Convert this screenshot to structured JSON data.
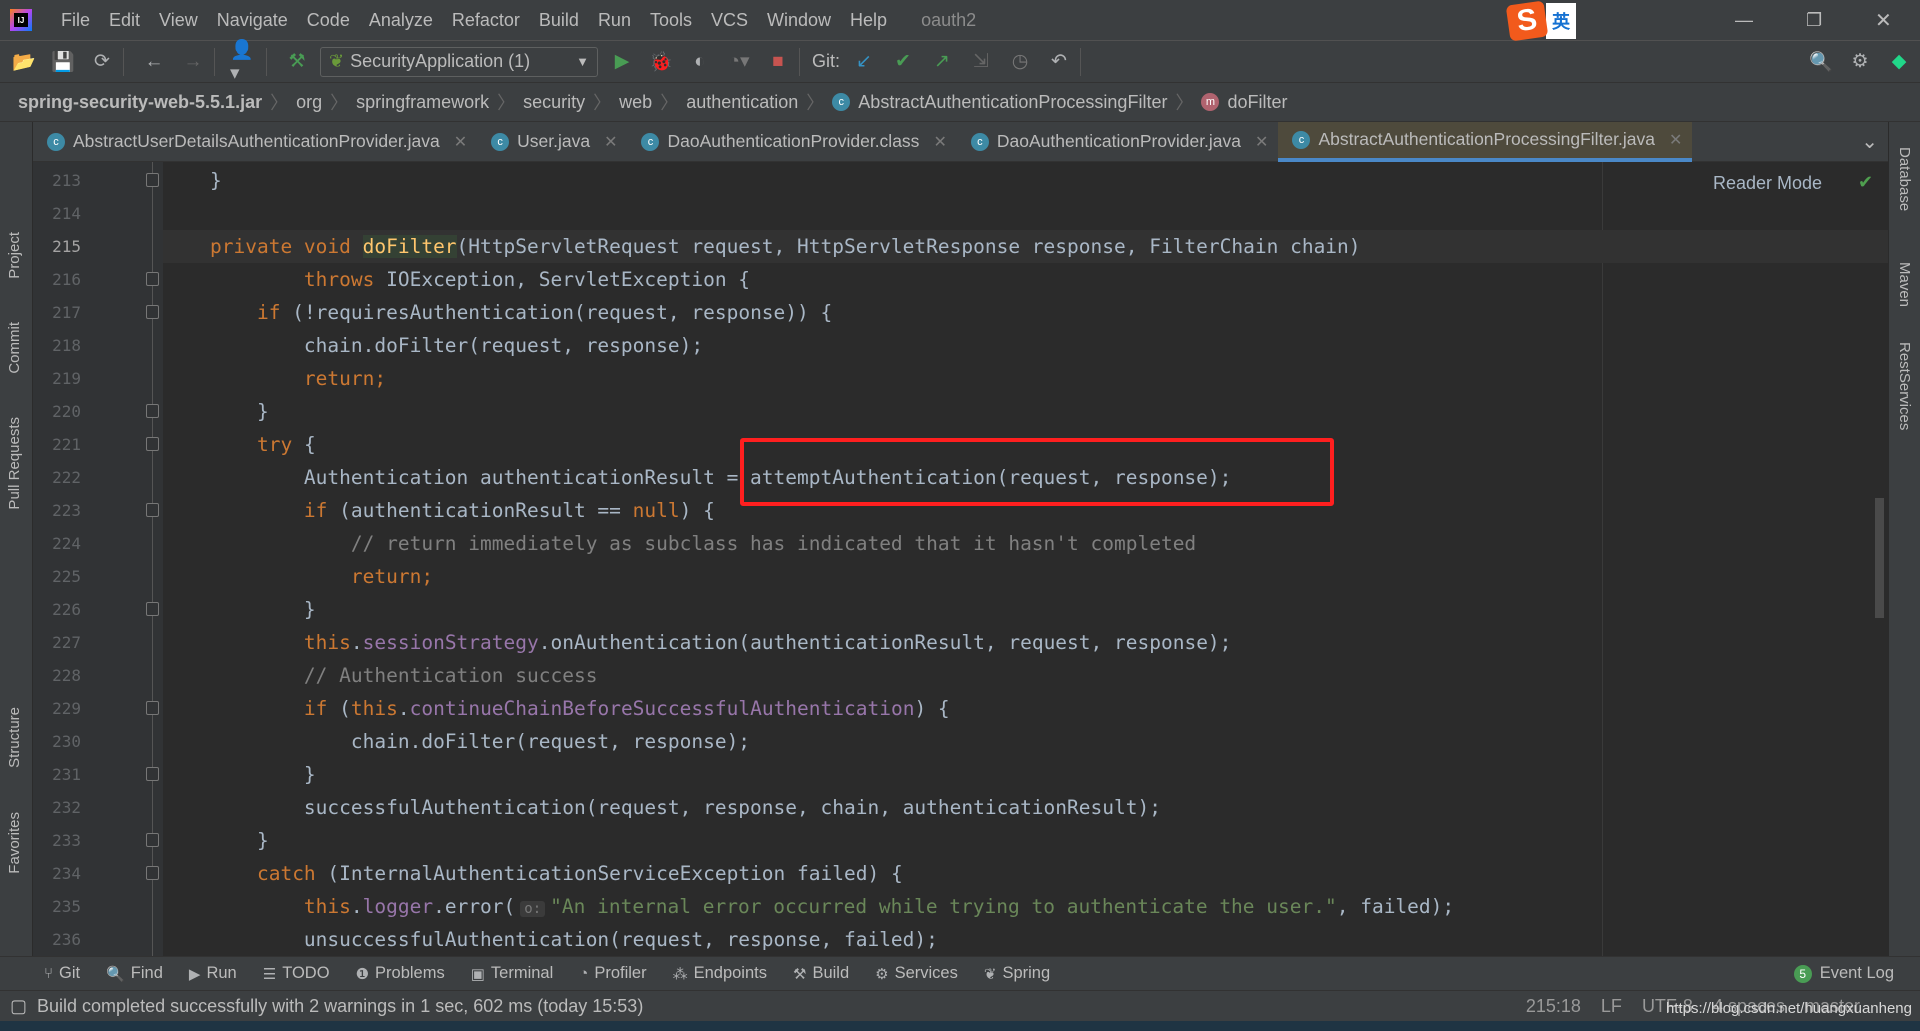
{
  "menubar": {
    "items": [
      "File",
      "Edit",
      "View",
      "Navigate",
      "Code",
      "Analyze",
      "Refactor",
      "Build",
      "Run",
      "Tools",
      "VCS",
      "Window",
      "Help"
    ],
    "project": "oauth2",
    "ime": "英"
  },
  "toolbar": {
    "run_config": "SecurityApplication (1)",
    "git_label": "Git:"
  },
  "breadcrumb": [
    "spring-security-web-5.5.1.jar",
    "org",
    "springframework",
    "security",
    "web",
    "authentication",
    "AbstractAuthenticationProcessingFilter",
    "doFilter"
  ],
  "tabs": [
    {
      "label": "AbstractUserDetailsAuthenticationProvider.java",
      "active": false
    },
    {
      "label": "User.java",
      "active": false
    },
    {
      "label": "DaoAuthenticationProvider.class",
      "active": false
    },
    {
      "label": "DaoAuthenticationProvider.java",
      "active": false
    },
    {
      "label": "AbstractAuthenticationProcessingFilter.java",
      "active": true
    }
  ],
  "left_tools": [
    "Project",
    "Commit",
    "Pull Requests",
    "Structure",
    "Favorites"
  ],
  "right_tools": [
    "Database",
    "Maven",
    "RestServices"
  ],
  "editor": {
    "reader_mode": "Reader Mode",
    "current_line": 215,
    "highlight_color": "#ff1f1f",
    "lines": [
      {
        "n": 213,
        "fold": true,
        "t": [
          [
            "}",
            ""
          ]
        ]
      },
      {
        "n": 214,
        "t": []
      },
      {
        "n": 215,
        "t": [
          [
            "private void ",
            "k"
          ],
          [
            "doFilter",
            "m"
          ],
          [
            "(HttpServletRequest request, HttpServletResponse response, FilterChain chain)",
            ""
          ]
        ]
      },
      {
        "n": 216,
        "fold": true,
        "t": [
          [
            "    throws ",
            "k"
          ],
          [
            "IOException, ServletException {",
            ""
          ]
        ]
      },
      {
        "n": 217,
        "fold": true,
        "t": [
          [
            "if ",
            "k"
          ],
          [
            "(!requiresAuthentication(request, response)) {",
            ""
          ]
        ]
      },
      {
        "n": 218,
        "t": [
          [
            "    chain.doFilter(request, response);",
            ""
          ]
        ]
      },
      {
        "n": 219,
        "t": [
          [
            "    return;",
            "k"
          ]
        ]
      },
      {
        "n": 220,
        "fold": true,
        "t": [
          [
            "}",
            ""
          ]
        ]
      },
      {
        "n": 221,
        "fold": true,
        "t": [
          [
            "try ",
            "k"
          ],
          [
            "{",
            ""
          ]
        ]
      },
      {
        "n": 222,
        "t": [
          [
            "    Authentication authenticationResult = attemptAuthentication(request, response);",
            ""
          ]
        ]
      },
      {
        "n": 223,
        "fold": true,
        "t": [
          [
            "    if ",
            "k"
          ],
          [
            "(authenticationResult == ",
            ""
          ],
          [
            "null",
            "k"
          ],
          [
            ") {",
            ""
          ]
        ]
      },
      {
        "n": 224,
        "t": [
          [
            "        // return immediately as subclass has indicated that it hasn't completed",
            "c"
          ]
        ]
      },
      {
        "n": 225,
        "t": [
          [
            "        return;",
            "k"
          ]
        ]
      },
      {
        "n": 226,
        "fold": true,
        "t": [
          [
            "    }",
            ""
          ]
        ]
      },
      {
        "n": 227,
        "t": [
          [
            "    this",
            "k"
          ],
          [
            ".",
            ""
          ],
          [
            "sessionStrategy",
            "f"
          ],
          [
            ".onAuthentication(authenticationResult, request, response);",
            ""
          ]
        ]
      },
      {
        "n": 228,
        "t": [
          [
            "    // Authentication success",
            "c"
          ]
        ]
      },
      {
        "n": 229,
        "fold": true,
        "t": [
          [
            "    if ",
            "k"
          ],
          [
            "(",
            ""
          ],
          [
            "this",
            "k"
          ],
          [
            ".",
            ""
          ],
          [
            "continueChainBeforeSuccessfulAuthentication",
            "f"
          ],
          [
            ") {",
            ""
          ]
        ]
      },
      {
        "n": 230,
        "t": [
          [
            "        chain.doFilter(request, response);",
            ""
          ]
        ]
      },
      {
        "n": 231,
        "fold": true,
        "t": [
          [
            "    }",
            ""
          ]
        ]
      },
      {
        "n": 232,
        "t": [
          [
            "    successfulAuthentication(request, response, chain, authenticationResult);",
            ""
          ]
        ]
      },
      {
        "n": 233,
        "fold": true,
        "t": [
          [
            "}",
            ""
          ]
        ]
      },
      {
        "n": 234,
        "fold": true,
        "t": [
          [
            "catch ",
            "k"
          ],
          [
            "(InternalAuthenticationServiceException failed) {",
            ""
          ]
        ]
      },
      {
        "n": 235,
        "t": [
          [
            "    this",
            "k"
          ],
          [
            ".",
            ""
          ],
          [
            "logger",
            "f"
          ],
          [
            ".error(",
            ""
          ],
          [
            "o:",
            "hint"
          ],
          [
            "\"An internal error occurred while trying to authenticate the user.\"",
            "s"
          ],
          [
            ", failed);",
            ""
          ]
        ]
      },
      {
        "n": 236,
        "t": [
          [
            "    unsuccessfulAuthentication(request, response, failed);",
            ""
          ]
        ]
      }
    ]
  },
  "toolwindows": [
    "Git",
    "Find",
    "Run",
    "TODO",
    "Problems",
    "Terminal",
    "Profiler",
    "Endpoints",
    "Build",
    "Services",
    "Spring"
  ],
  "event_log": "Event Log",
  "event_count": "5",
  "status": {
    "message": "Build completed successfully with 2 warnings in 1 sec, 602 ms (today 15:53)",
    "position": "215:18",
    "line_sep": "LF",
    "encoding": "UTF-8",
    "indent": "4 spaces",
    "branch": "master",
    "watermark": "https://blog.csdn.net/huangxuanheng"
  }
}
